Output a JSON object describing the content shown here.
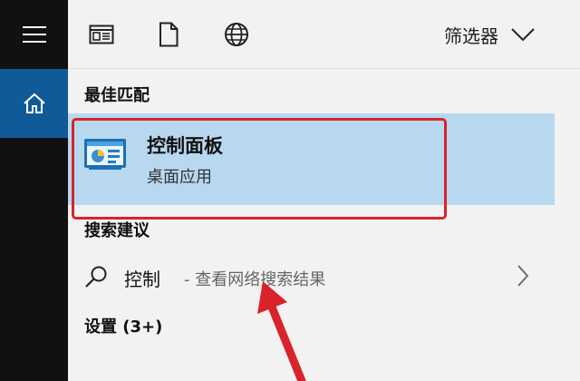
{
  "toolbar": {
    "filter_label": "筛选器"
  },
  "sections": {
    "best_match_title": "最佳匹配",
    "search_suggestions_title": "搜索建议",
    "settings_title": "设置 (3+)"
  },
  "best_match": {
    "title": "控制面板",
    "subtitle": "桌面应用"
  },
  "suggestion": {
    "query": "控制",
    "hint": "- 查看网络搜索结果"
  },
  "colors": {
    "rail": "#111111",
    "rail_active": "#0f5a97",
    "result_highlight": "#b8d8f0",
    "annotation_red": "#d9232a"
  },
  "icons": {
    "menu": "hamburger-icon",
    "home": "home-icon",
    "apps": "apps-icon",
    "documents": "document-icon",
    "web": "globe-icon",
    "filter": "chevron-down-icon",
    "app": "control-panel-icon",
    "search": "search-icon",
    "go": "chevron-right-icon"
  }
}
